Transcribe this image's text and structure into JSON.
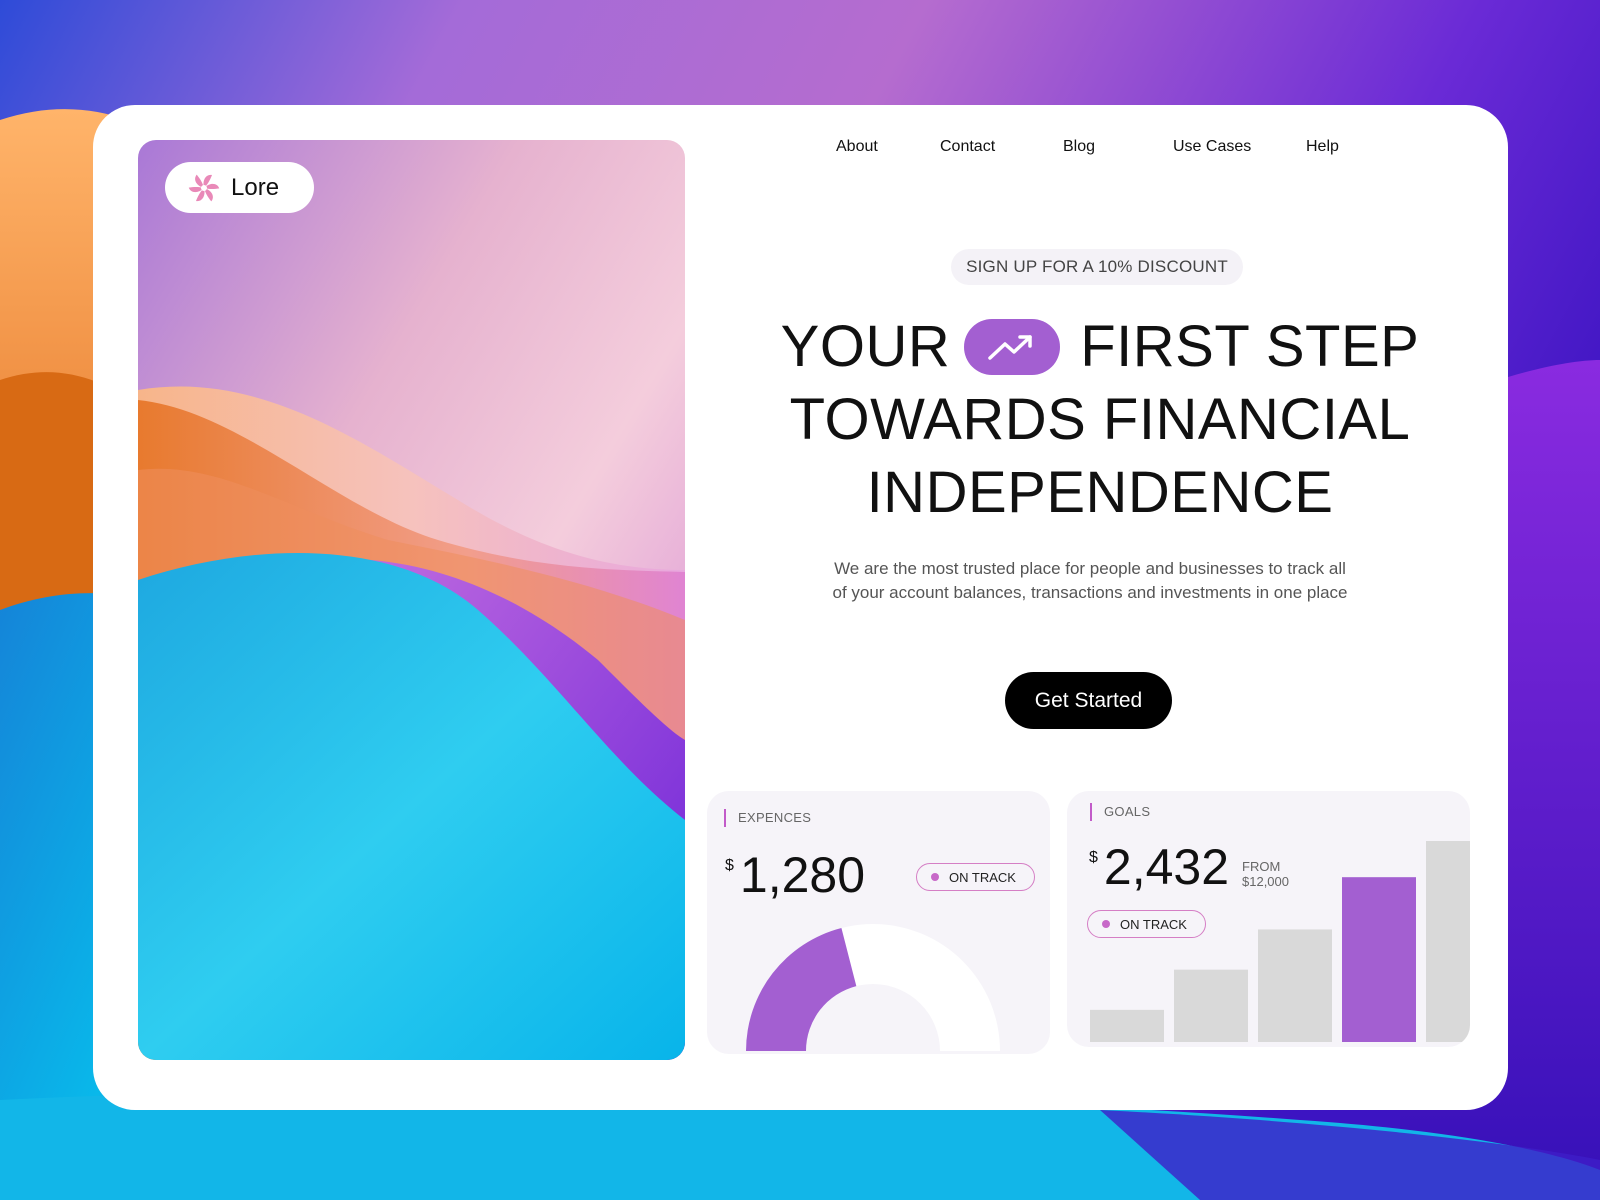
{
  "brand": {
    "name": "Lore",
    "logo_icon": "pinwheel-flower-icon",
    "accent": "#a35fd1"
  },
  "nav": {
    "items": [
      {
        "label": "About"
      },
      {
        "label": "Contact"
      },
      {
        "label": "Blog"
      },
      {
        "label": "Use Cases"
      },
      {
        "label": "Help"
      }
    ]
  },
  "hero": {
    "discount": "SIGN UP FOR A 10% DISCOUNT",
    "headline_line1_a": "YOUR",
    "headline_line1_b": "FIRST STEP",
    "headline_line2": "TOWARDS FINANCIAL",
    "headline_line3": "INDEPENDENCE",
    "trend_icon": "trending-up-icon",
    "subtext": "We are the most trusted place for people and businesses to track all of your account balances, transactions and investments in one place",
    "cta": "Get Started"
  },
  "expenses_card": {
    "label": "EXPENCES",
    "currency": "$",
    "amount": "1,280",
    "status": "ON TRACK",
    "progress_fraction": 0.6
  },
  "goals_card": {
    "label": "GOALS",
    "currency": "$",
    "amount": "2,432",
    "from_label": "FROM",
    "from_amount": "$12,000",
    "status": "ON TRACK",
    "bars": [
      0.16,
      0.36,
      0.56,
      0.82,
      1.0
    ],
    "highlight_index": 3
  },
  "colors": {
    "bar_default": "#d9d9d9",
    "bar_highlight": "#a35fd1",
    "badge_border": "#d57ec5",
    "badge_dot": "#c768c8",
    "label_rule": "#c25bc9"
  }
}
